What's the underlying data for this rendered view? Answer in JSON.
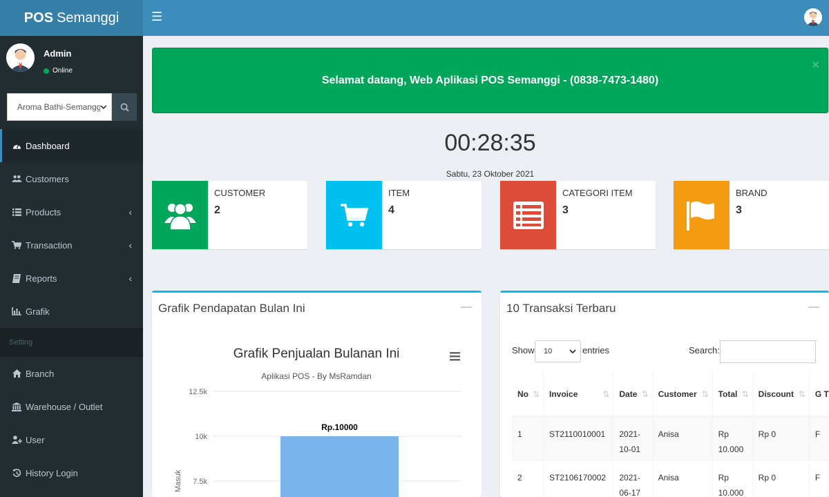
{
  "header": {
    "logo_bold": "POS",
    "logo_rest": "Semanggi"
  },
  "user": {
    "name": "Admin",
    "status": "Online"
  },
  "branch": {
    "selected": "Aroma Bathi-Semanggi"
  },
  "sidebar": {
    "items": [
      {
        "label": "Dashboard"
      },
      {
        "label": "Customers"
      },
      {
        "label": "Products"
      },
      {
        "label": "Transaction"
      },
      {
        "label": "Reports"
      },
      {
        "label": "Grafik"
      }
    ],
    "setting_header": "Setting",
    "setting_items": [
      {
        "label": "Branch"
      },
      {
        "label": "Warehouse / Outlet"
      },
      {
        "label": "User"
      },
      {
        "label": "History Login"
      }
    ]
  },
  "alert": {
    "message": "Selamat datang, Web Aplikasi POS Semanggi - (0838-7473-1480)"
  },
  "clock": {
    "time": "00:28:35",
    "date": "Sabtu, 23 Oktober 2021"
  },
  "info_boxes": [
    {
      "label": "CUSTOMER",
      "value": "2",
      "color": "#00a65a",
      "icon": "users-icon"
    },
    {
      "label": "ITEM",
      "value": "4",
      "color": "#00c0ef",
      "icon": "cart-icon"
    },
    {
      "label": "CATEGORI ITEM",
      "value": "3",
      "color": "#dd4b39",
      "icon": "list-icon"
    },
    {
      "label": "BRAND",
      "value": "3",
      "color": "#f39c12",
      "icon": "flag-icon"
    }
  ],
  "chart_box": {
    "title": "Grafik Pendapatan Bulan Ini"
  },
  "chart_data": {
    "type": "bar",
    "title": "Grafik Penjualan Bulanan Ini",
    "subtitle": "Aplikasi POS - By MsRamdan",
    "ylabel": "Masuk",
    "ytick_labels": [
      "12.5k",
      "10k",
      "7.5k"
    ],
    "yticks": [
      12500,
      10000,
      7500
    ],
    "series": [
      {
        "values": [
          10000
        ],
        "data_labels": [
          "Rp.10000"
        ],
        "color": "#7cb5ec"
      }
    ]
  },
  "table_box": {
    "title": "10 Transaksi Terbaru",
    "show_label": "Show",
    "length_value": "10",
    "entries_label": "entries",
    "search_label": "Search:",
    "columns": [
      "No",
      "Invoice",
      "Date",
      "Customer",
      "Total",
      "Discount",
      "G T"
    ],
    "rows": [
      {
        "no": "1",
        "invoice": "ST2110010001",
        "date_a": "2021-",
        "date_b": "10-01",
        "customer": "Anisa",
        "total_a": "Rp",
        "total_b": "10.000",
        "discount": "Rp 0",
        "gt": "F"
      },
      {
        "no": "2",
        "invoice": "ST2106170002",
        "date_a": "2021-",
        "date_b": "06-17",
        "customer": "Anisa",
        "total_a": "Rp",
        "total_b": "10.000",
        "discount": "Rp 0",
        "gt": "F"
      }
    ]
  }
}
